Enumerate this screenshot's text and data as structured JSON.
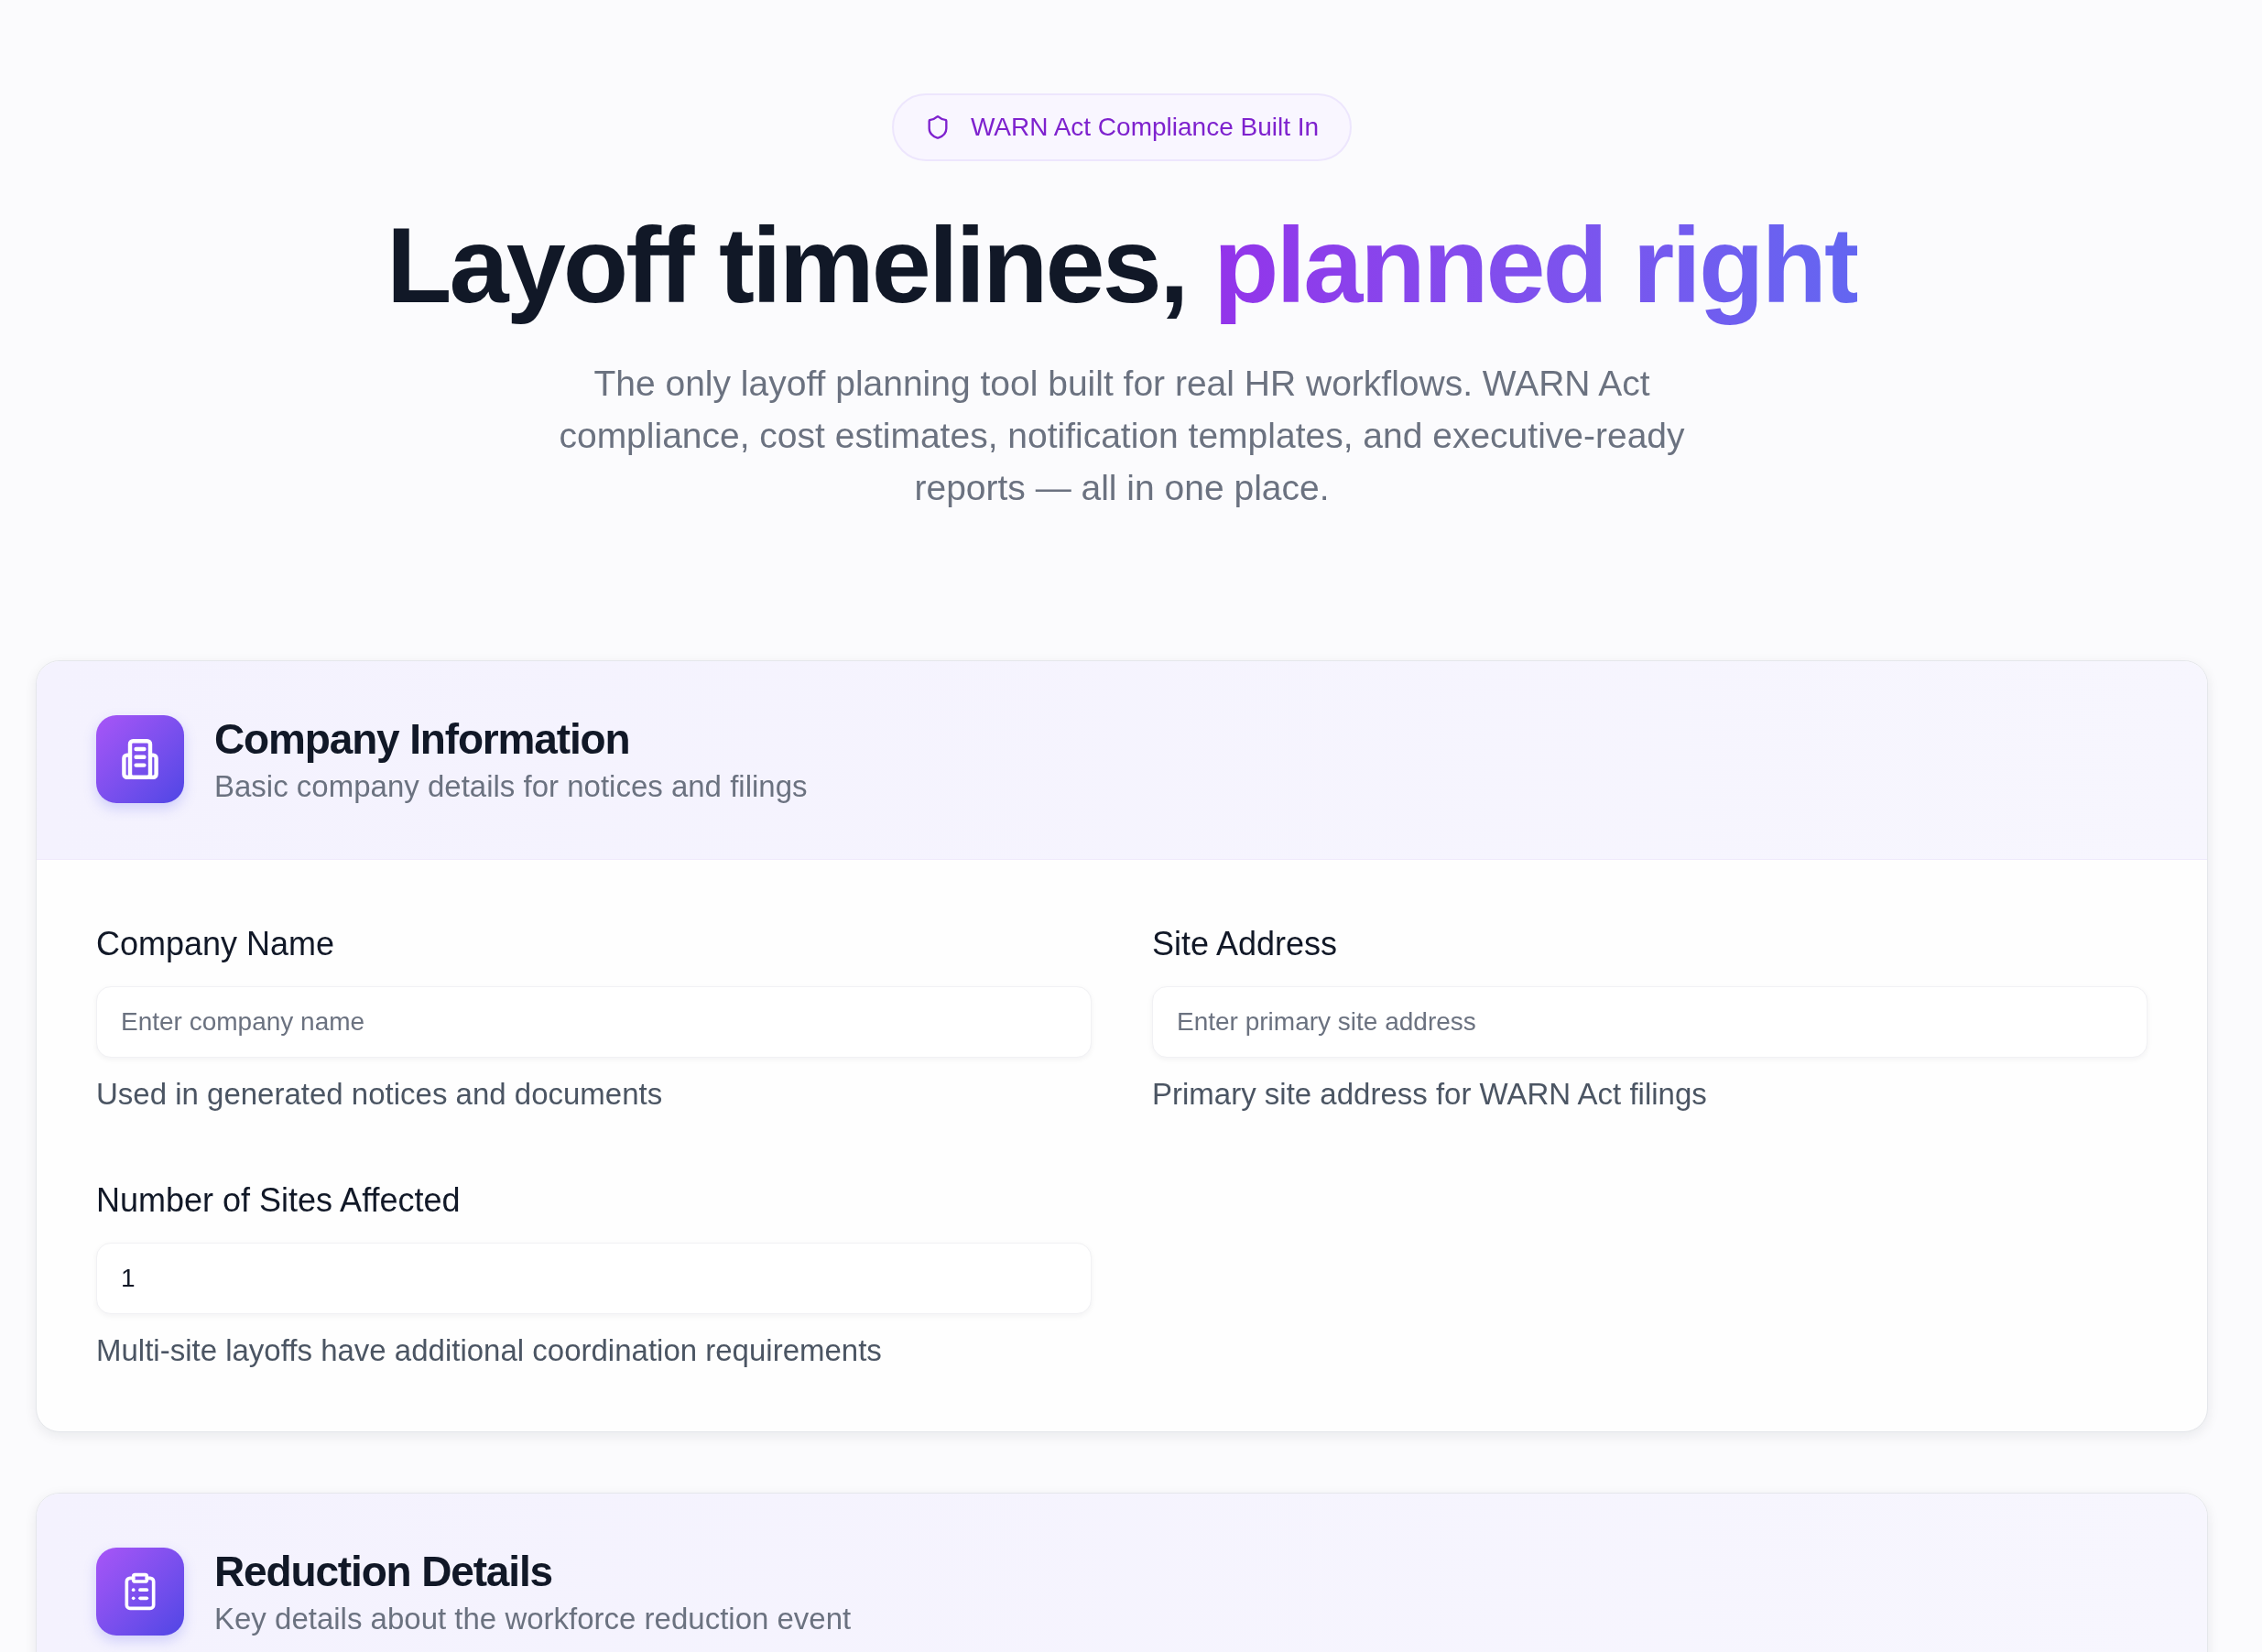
{
  "badge": {
    "label": "WARN Act Compliance Built In"
  },
  "hero": {
    "title": "Layoff timelines,",
    "title_accent": "planned right",
    "subtitle": "The only layoff planning tool built for real HR workflows. WARN Act compliance, cost estimates, notification templates, and executive-ready reports — all in one place."
  },
  "sections": [
    {
      "title": "Company Information",
      "subtitle": "Basic company details for notices and filings",
      "fields": [
        {
          "label": "Company Name",
          "placeholder": "Enter company name",
          "help": "Used in generated notices and documents"
        },
        {
          "label": "Site Address",
          "placeholder": "Enter primary site address",
          "help": "Primary site address for WARN Act filings"
        },
        {
          "label": "Number of Sites Affected",
          "value": "1",
          "help": "Multi-site layoffs have additional coordination requirements"
        }
      ]
    },
    {
      "title": "Reduction Details",
      "subtitle": "Key details about the workforce reduction event"
    }
  ]
}
